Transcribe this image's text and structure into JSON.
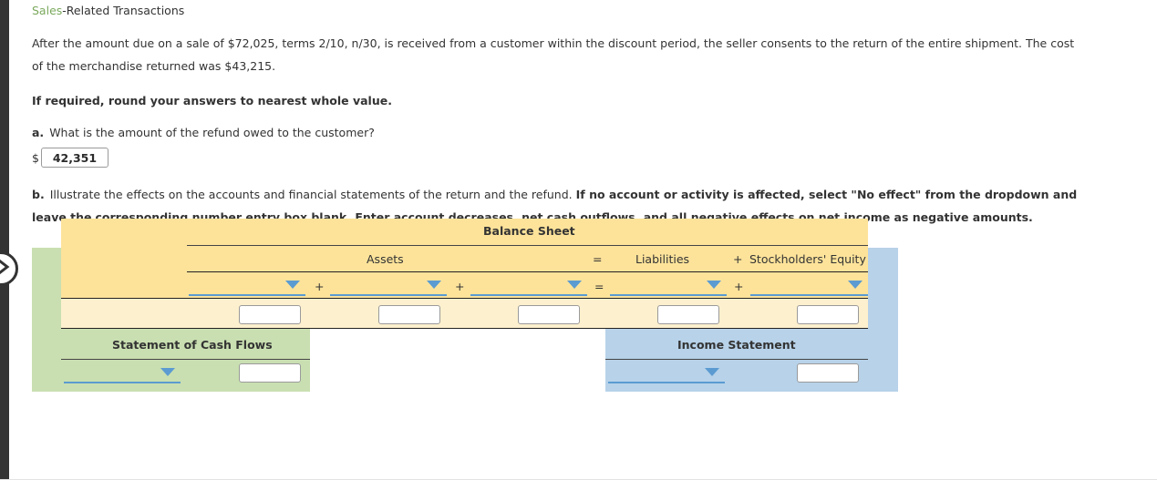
{
  "sidebar": {
    "expand_icon": "chevron-right-icon"
  },
  "question": {
    "title_highlight": "Sales",
    "title_rest": "-Related Transactions",
    "scenario_1": "After the amount due on a sale of $72,025, terms 2/10, n/30, is received from a customer within the discount period, the seller consents to the return of the entire shipment. The cost of the",
    "scenario_2": "merchandise returned was $43,215.",
    "rounding_note": "If required, round your answers to nearest whole value.",
    "part_a": {
      "letter": "a.",
      "text": "What is the amount of the refund owed to the customer?",
      "currency_symbol": "$",
      "answer_value": "42,351"
    },
    "part_b": {
      "letter": "b.",
      "text_normal_1": "Illustrate the effects on the accounts and financial statements of the return and the refund. ",
      "text_bold_1": "If no account or activity is affected, select \"No effect\" from the dropdown and leave the",
      "text_bold_2": "corresponding number entry box blank. Enter account decreases, net cash outflows, and all negative effects on net income as negative amounts."
    }
  },
  "grid": {
    "balance_sheet_title": "Balance Sheet",
    "assets_header": "Assets",
    "equals_header": "=",
    "liabilities_header": "Liabilities",
    "plus_header": "+",
    "equity_header": "Stockholders' Equity",
    "operators": {
      "asset_plus_1": "+",
      "asset_plus_2": "+",
      "equals": "=",
      "liab_plus": "+"
    },
    "dropdowns": {
      "asset_1": "",
      "asset_2": "",
      "asset_3": "",
      "liability_1": "",
      "equity_1": "",
      "cash_flow_1": "",
      "income_1": ""
    },
    "amount_inputs": {
      "asset_1": "",
      "asset_2": "",
      "asset_3": "",
      "liability_1": "",
      "equity_1": "",
      "cash_flow_1": "",
      "income_1": ""
    },
    "cash_flows_title": "Statement of Cash Flows",
    "income_statement_title": "Income Statement"
  }
}
